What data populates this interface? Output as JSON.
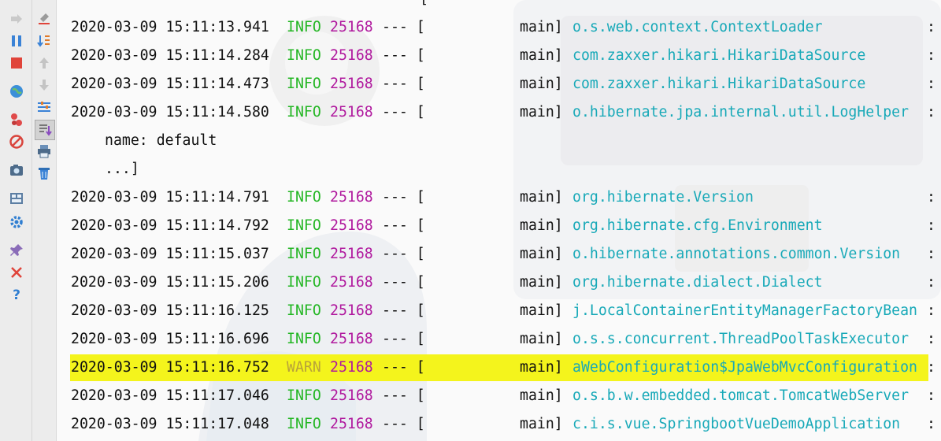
{
  "toolbar": {
    "col1": [
      {
        "name": "rerun-icon"
      },
      {
        "name": "pause-icon"
      },
      {
        "name": "stop-icon"
      },
      {
        "name": "globe-icon"
      },
      {
        "name": "dump-threads-icon"
      },
      {
        "name": "mute-breakpoints-icon"
      },
      {
        "name": "camera-icon"
      },
      {
        "name": "layout-icon"
      },
      {
        "name": "settings-icon"
      },
      {
        "name": "pin-icon"
      },
      {
        "name": "close-icon"
      },
      {
        "name": "help-icon"
      }
    ],
    "col2": [
      {
        "name": "clear-icon"
      },
      {
        "name": "soft-wrap-icon"
      },
      {
        "name": "up-arrow-icon"
      },
      {
        "name": "down-arrow-icon"
      },
      {
        "name": "filter-icon"
      },
      {
        "name": "scroll-to-end-icon"
      },
      {
        "name": "print-icon"
      },
      {
        "name": "trash-icon"
      }
    ]
  },
  "colors": {
    "info": "#23b623",
    "warn": "#b8a23a",
    "pid": "#b0199e",
    "logger": "#18a9b8",
    "highlight": "#f4f41c"
  },
  "log": [
    {
      "type": "entry",
      "ts": "2020-03-09 15:11:13.941",
      "level": "INFO",
      "pid": "25168",
      "sep": "--- [",
      "thread": "main]",
      "logger": "o.s.web.context.ContextLoader",
      "colon": ":"
    },
    {
      "type": "entry",
      "ts": "2020-03-09 15:11:14.284",
      "level": "INFO",
      "pid": "25168",
      "sep": "--- [",
      "thread": "main]",
      "logger": "com.zaxxer.hikari.HikariDataSource",
      "colon": ":"
    },
    {
      "type": "entry",
      "ts": "2020-03-09 15:11:14.473",
      "level": "INFO",
      "pid": "25168",
      "sep": "--- [",
      "thread": "main]",
      "logger": "com.zaxxer.hikari.HikariDataSource",
      "colon": ":"
    },
    {
      "type": "entry",
      "ts": "2020-03-09 15:11:14.580",
      "level": "INFO",
      "pid": "25168",
      "sep": "--- [",
      "thread": "main]",
      "logger": "o.hibernate.jpa.internal.util.LogHelper",
      "colon": ":"
    },
    {
      "type": "cont",
      "text": "name: default"
    },
    {
      "type": "cont",
      "text": "...]"
    },
    {
      "type": "entry",
      "ts": "2020-03-09 15:11:14.791",
      "level": "INFO",
      "pid": "25168",
      "sep": "--- [",
      "thread": "main]",
      "logger": "org.hibernate.Version",
      "colon": ":"
    },
    {
      "type": "entry",
      "ts": "2020-03-09 15:11:14.792",
      "level": "INFO",
      "pid": "25168",
      "sep": "--- [",
      "thread": "main]",
      "logger": "org.hibernate.cfg.Environment",
      "colon": ":"
    },
    {
      "type": "entry",
      "ts": "2020-03-09 15:11:15.037",
      "level": "INFO",
      "pid": "25168",
      "sep": "--- [",
      "thread": "main]",
      "logger": "o.hibernate.annotations.common.Version",
      "colon": ":"
    },
    {
      "type": "entry",
      "ts": "2020-03-09 15:11:15.206",
      "level": "INFO",
      "pid": "25168",
      "sep": "--- [",
      "thread": "main]",
      "logger": "org.hibernate.dialect.Dialect",
      "colon": ":"
    },
    {
      "type": "entry",
      "ts": "2020-03-09 15:11:16.125",
      "level": "INFO",
      "pid": "25168",
      "sep": "--- [",
      "thread": "main]",
      "logger": "j.LocalContainerEntityManagerFactoryBean",
      "colon": ":"
    },
    {
      "type": "entry",
      "ts": "2020-03-09 15:11:16.696",
      "level": "INFO",
      "pid": "25168",
      "sep": "--- [",
      "thread": "main]",
      "logger": "o.s.s.concurrent.ThreadPoolTaskExecutor",
      "colon": ":"
    },
    {
      "type": "entry",
      "ts": "2020-03-09 15:11:16.752",
      "level": "WARN",
      "pid": "25168",
      "sep": "--- [",
      "thread": "main]",
      "logger": "aWebConfiguration$JpaWebMvcConfiguration",
      "colon": ":",
      "highlight": true
    },
    {
      "type": "entry",
      "ts": "2020-03-09 15:11:17.046",
      "level": "INFO",
      "pid": "25168",
      "sep": "--- [",
      "thread": "main]",
      "logger": "o.s.b.w.embedded.tomcat.TomcatWebServer",
      "colon": ":"
    },
    {
      "type": "entry",
      "ts": "2020-03-09 15:11:17.048",
      "level": "INFO",
      "pid": "25168",
      "sep": "--- [",
      "thread": "main]",
      "logger": "c.i.s.vue.SpringbootVueDemoApplication",
      "colon": ":"
    }
  ]
}
